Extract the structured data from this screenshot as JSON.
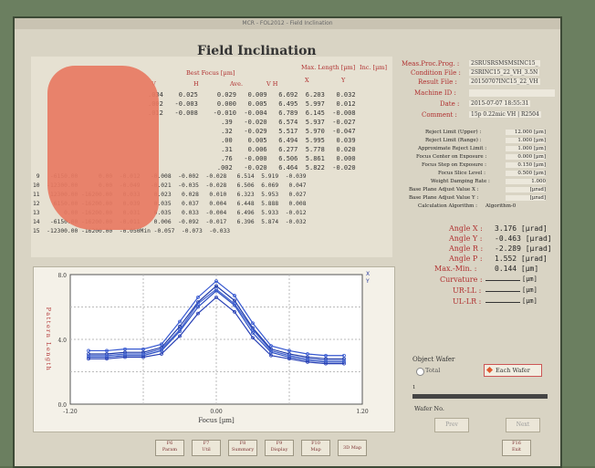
{
  "window": {
    "title": "MCR - FOL2012 - Field Inclination",
    "app_title": "Field Inclination"
  },
  "table": {
    "headers": {
      "best_focus": "Best Focus [µm]",
      "max_length": "Max. Length [µm]",
      "inc": "Inc. [µm]",
      "v": "V",
      "h": "H",
      "ave": "Ave.",
      "vh": "V H",
      "x": "X",
      "y": "Y"
    },
    "rows_top": [
      ".034    0.025     0.029   0.009   6.692  6.203   0.032",
      ".002   -0.003     0.000   0.005   6.495  5.997   0.012",
      ".012   -0.008    -0.010  -0.004   6.789  6.145  -0.008",
      "                   .39   -0.020   6.574  5.937  -0.027",
      "                   .32   -0.029   5.517  5.970  -0.047",
      "                   .00    0.005   6.494  5.995   0.039",
      "                   .31    0.006   6.277  5.778   0.020",
      "                   .76   -0.000   6.506  5.861   0.000",
      "                  .002   -0.020   6.464  5.822  -0.020"
    ],
    "rows_bottom": [
      " 9   -6150.00      0.00  -0.012   -0.008  -0.002  -0.028   6.514  5.919  -0.039",
      "10  -12300.00      0.00  -0.049   -0.021  -0.035  -0.028   6.506  6.069   0.047",
      "11   12300.00 -16200.00   0.033    0.023   0.028   0.010   6.323  5.953   0.027",
      "12    6150.00 -16200.00   0.039    0.035   0.037   0.004   6.448  5.888   0.008",
      "13       0.00 -16200.00   0.031    0.035   0.033  -0.004   6.496  5.933  -0.012",
      "14   -6150.00 -16200.00  -0.011    0.006  -0.092  -0.017   6.396  5.874  -0.032",
      "15  -12300.00 -16200.00  -0.050Min -0.057  -0.073  -0.033"
    ]
  },
  "info": {
    "labels": [
      "Meas.Proc.Prog. :",
      "Condition File :",
      "Result File :",
      "Machine ID :",
      "Date :",
      "Comment :"
    ],
    "values": [
      "2SRUSRSMSMSINC15_",
      "2SRINC15_22_VH_3.5N",
      "20150707INC15_22_VH",
      "",
      "2015-07-07 18:55:31",
      "15p 0.22mic VH | R2504"
    ]
  },
  "params": {
    "labels": [
      "Reject Limit (Upper) :",
      "Reject Limit (Range) :",
      "Approximate Reject Limit :",
      "Focus Center on Exposure :",
      "Focus Step on Exposure :",
      "Focus Slice Level :",
      "Weight Damping Rate :",
      "Base Plane Adjust Value X :",
      "Base Plane Adjust Value Y :",
      "Calculation Algorithm :"
    ],
    "values": [
      "12.000 [µm]",
      "1.000 [µm]",
      "1.000 [µm]",
      "0.000 [µm]",
      "0.150 [µm]",
      "0.500 [µm]",
      "1.000",
      "[µrad]",
      "[µrad]",
      "Algorithm-0"
    ]
  },
  "angles": {
    "labels": [
      "Angle X :",
      "Angle Y :",
      "Angle R :",
      "Angle P :",
      "Max.-Min. :",
      "Curvature :",
      "UR-LL :",
      "UL-LR :"
    ],
    "values": [
      "3.176 [µrad]",
      "-0.463 [µrad]",
      "-2.289 [µrad]",
      "1.552 [µrad]",
      "0.144 [µm]",
      "[µm]",
      "[µm]",
      "[µm]"
    ]
  },
  "object": {
    "label": "Object Wafer",
    "total": "Total",
    "each_wafer": "Each Wafer",
    "slider_value": "1",
    "wafer_no": "Wafer No.",
    "prev": "Prev",
    "next": "Next"
  },
  "legend": {
    "x": "X",
    "y": "Y"
  },
  "chart_data": {
    "type": "line",
    "ylabel": "Pattern Length",
    "xlabel": "Focus [µm]",
    "xlim": [
      -1.2,
      1.2
    ],
    "ylim": [
      0.0,
      8.0
    ],
    "x_ticks": [
      "-1.20",
      "0.00",
      "1.20"
    ],
    "y_ticks": [
      "8.0",
      "4.0",
      "0.0"
    ],
    "x": [
      -1.05,
      -0.9,
      -0.75,
      -0.6,
      -0.45,
      -0.3,
      -0.15,
      0.0,
      0.15,
      0.3,
      0.45,
      0.6,
      0.75,
      0.9,
      1.05
    ],
    "series": [
      {
        "values": [
          3.1,
          3.1,
          3.2,
          3.2,
          3.5,
          4.8,
          6.3,
          7.3,
          6.4,
          4.7,
          3.4,
          3.1,
          2.9,
          2.8,
          2.8
        ]
      },
      {
        "values": [
          2.9,
          2.9,
          3.0,
          3.0,
          3.3,
          4.5,
          6.0,
          7.0,
          6.1,
          4.4,
          3.2,
          2.9,
          2.7,
          2.6,
          2.6
        ]
      },
      {
        "values": [
          3.3,
          3.3,
          3.4,
          3.4,
          3.7,
          5.1,
          6.6,
          7.6,
          6.7,
          5.0,
          3.6,
          3.3,
          3.1,
          3.0,
          3.0
        ]
      },
      {
        "values": [
          2.8,
          2.8,
          2.9,
          2.9,
          3.1,
          4.2,
          5.6,
          6.6,
          5.7,
          4.1,
          3.0,
          2.8,
          2.6,
          2.5,
          2.5
        ]
      },
      {
        "values": [
          3.0,
          3.0,
          3.1,
          3.1,
          3.4,
          4.6,
          6.2,
          7.1,
          6.2,
          4.6,
          3.3,
          3.0,
          2.8,
          2.7,
          2.7
        ]
      }
    ]
  },
  "buttons": [
    {
      "key": "F6",
      "label": "Param"
    },
    {
      "key": "F7",
      "label": "Util"
    },
    {
      "key": "F8",
      "label": "Summary"
    },
    {
      "key": "F9",
      "label": "Display"
    },
    {
      "key": "F10",
      "label": "Map"
    },
    {
      "key": "",
      "label": "3D Map"
    },
    {
      "key": "F16",
      "label": "Exit"
    }
  ]
}
